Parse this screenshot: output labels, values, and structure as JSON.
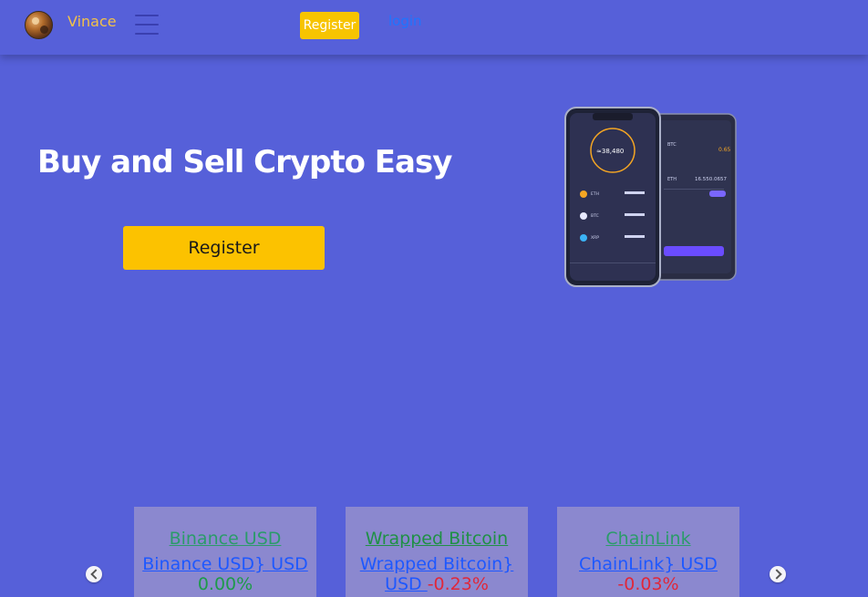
{
  "navbar": {
    "brand": "Vinace",
    "register_label": "Register",
    "login_label": "login"
  },
  "hero": {
    "title": "Buy and Sell Crypto Easy",
    "register_label": "Register"
  },
  "cards": [
    {
      "name": "Binance USD",
      "pair": "Binance USD} USD",
      "change": "0.00%"
    },
    {
      "name": "Wrapped Bitcoin",
      "pair": "Wrapped Bitcoin} USD",
      "change": "-0.23%"
    },
    {
      "name": "ChainLink",
      "pair": "ChainLink} USD",
      "change": "-0.03%"
    }
  ],
  "carousel": {
    "prev_icon": "chevron-left-icon",
    "next_icon": "chevron-right-icon"
  },
  "phone_mockup": {
    "balance": "≈38,480",
    "coins": [
      "ETH",
      "BTC",
      "XRP"
    ],
    "right_values": [
      "0.65",
      "16.550.0657"
    ]
  },
  "colors": {
    "background": "#5660d9",
    "accent": "#fcc200",
    "brand": "#f2c14a",
    "link": "#1e58ff",
    "positive": "#1e9a4a",
    "negative": "#e0283a",
    "card": "#8b88cf"
  }
}
